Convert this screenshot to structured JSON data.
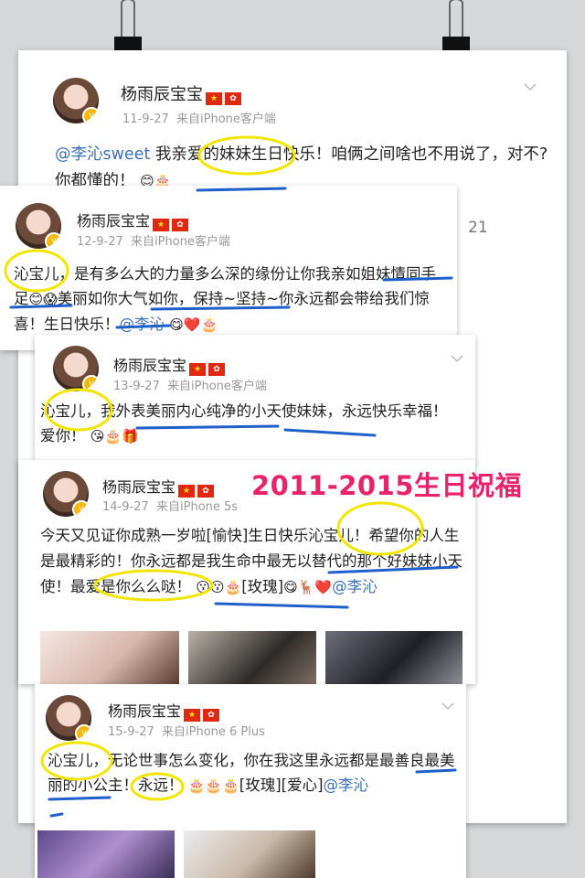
{
  "posts": [
    {
      "name": "杨雨辰宝宝",
      "date": "11-9-27",
      "source": "来自iPhone客户端",
      "text_mention": "@李沁sweet",
      "text_1": " 我亲爱的妹妹生日快乐！咱俩之间啥也不用说了，对不?你都懂的！"
    },
    {
      "name": "杨雨辰宝宝",
      "date": "12-9-27",
      "source": "来自iPhone客户端",
      "text_1": "沁宝儿，是有多么大的力量多么深的缘份让你我亲如姐妹情同手足",
      "text_2": "美丽如你大气如你，保持~坚持~你永远都会带给我们惊喜！生日快乐！",
      "text_mention": "@李沁"
    },
    {
      "name": "杨雨辰宝宝",
      "date": "13-9-27",
      "source": "来自iPhone客户端",
      "text_1": "沁宝儿，我外表美丽内心纯净的小天使妹妹，永远快乐幸福！爱你！"
    },
    {
      "name": "杨雨辰宝宝",
      "date": "14-9-27",
      "source": "来自iPhone 5s",
      "text_1": "今天又见证你成熟一岁啦[愉快]生日快乐沁宝儿！希望你的人生是最精彩的！你永远都是我生命中最无以替代的那个好妹妹小天使！最爱是你么么哒！",
      "text_2": "[玫瑰]",
      "text_mention": "@李沁"
    },
    {
      "name": "杨雨辰宝宝",
      "date": "15-9-27",
      "source": "来自iPhone 6 Plus",
      "text_1": "沁宝儿，无论世事怎么变化，你在我这里永远都是最善良最美丽的小公主！永远！",
      "text_2": "[玫瑰][爱心]",
      "text_mention": "@李沁"
    }
  ],
  "title_overlay": "2011-2015生日祝福",
  "comment_count": "21",
  "colors": {
    "name": "#222222",
    "meta": "#999999",
    "mention": "#3b6fb6",
    "title": "#e8236a",
    "highlight_yellow": "#f2e600",
    "underline_blue": "#1f5fc9"
  }
}
